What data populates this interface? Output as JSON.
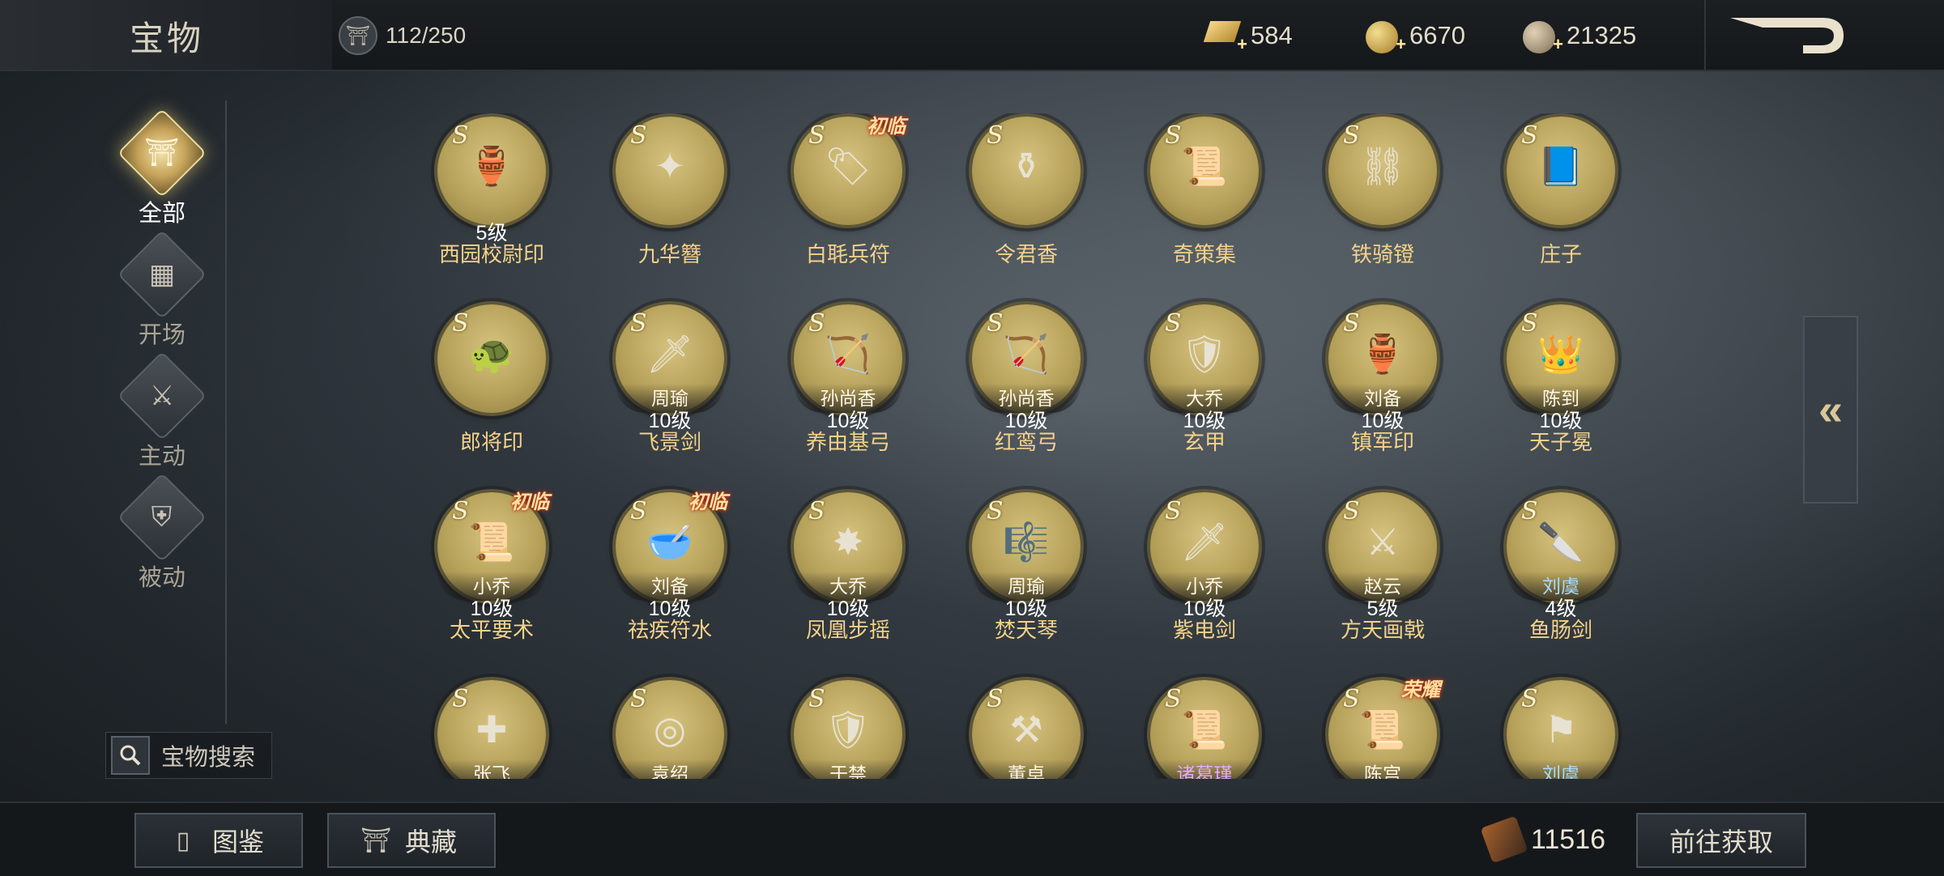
{
  "header": {
    "title": "宝物",
    "capacity": "112/250",
    "currencies": [
      {
        "name": "gold-ingot",
        "value": "584"
      },
      {
        "name": "gold-coin",
        "value": "6670"
      },
      {
        "name": "copper-coin",
        "value": "21325"
      }
    ]
  },
  "categories": [
    {
      "label": "全部",
      "icon": "treasure-icon",
      "active": true
    },
    {
      "label": "开场",
      "icon": "opening-icon",
      "active": false
    },
    {
      "label": "主动",
      "icon": "active-skill-icon",
      "active": false
    },
    {
      "label": "被动",
      "icon": "passive-skill-icon",
      "active": false
    }
  ],
  "search": {
    "label": "宝物搜索"
  },
  "items": [
    {
      "grade": "S",
      "tag": "",
      "owner": "",
      "level": "5级",
      "name": "西园校尉印",
      "art": "seal"
    },
    {
      "grade": "S",
      "tag": "",
      "owner": "",
      "level": "",
      "name": "九华簪",
      "art": "hairpin"
    },
    {
      "grade": "S",
      "tag": "初临",
      "owner": "",
      "level": "",
      "name": "白毦兵符",
      "art": "tally"
    },
    {
      "grade": "S",
      "tag": "",
      "owner": "",
      "level": "",
      "name": "令君香",
      "art": "censer"
    },
    {
      "grade": "S",
      "tag": "",
      "owner": "",
      "level": "",
      "name": "奇策集",
      "art": "scrolls"
    },
    {
      "grade": "S",
      "tag": "",
      "owner": "",
      "level": "",
      "name": "铁骑镫",
      "art": "stirrup"
    },
    {
      "grade": "S",
      "tag": "",
      "owner": "",
      "level": "",
      "name": "庄子",
      "art": "book"
    },
    {
      "grade": "S",
      "tag": "",
      "owner": "",
      "level": "",
      "name": "郎将印",
      "art": "turtle-seal"
    },
    {
      "grade": "S",
      "tag": "",
      "owner": "周瑜",
      "level": "10级",
      "name": "飞景剑",
      "art": "sword"
    },
    {
      "grade": "S",
      "tag": "",
      "owner": "孙尚香",
      "level": "10级",
      "name": "养由基弓",
      "art": "bow"
    },
    {
      "grade": "S",
      "tag": "",
      "owner": "孙尚香",
      "level": "10级",
      "name": "红鸾弓",
      "art": "bow"
    },
    {
      "grade": "S",
      "tag": "",
      "owner": "大乔",
      "level": "10级",
      "name": "玄甲",
      "art": "armor"
    },
    {
      "grade": "S",
      "tag": "",
      "owner": "刘备",
      "level": "10级",
      "name": "镇军印",
      "art": "seal"
    },
    {
      "grade": "S",
      "tag": "",
      "owner": "陈到",
      "level": "10级",
      "name": "天子冕",
      "art": "crown"
    },
    {
      "grade": "S",
      "tag": "初临",
      "owner": "小乔",
      "level": "10级",
      "name": "太平要术",
      "art": "scrolls"
    },
    {
      "grade": "S",
      "tag": "初临",
      "owner": "刘备",
      "level": "10级",
      "name": "祛疾符水",
      "art": "bowl"
    },
    {
      "grade": "S",
      "tag": "",
      "owner": "大乔",
      "level": "10级",
      "name": "凤凰步摇",
      "art": "phoenix"
    },
    {
      "grade": "S",
      "tag": "",
      "owner": "周瑜",
      "level": "10级",
      "name": "焚天琴",
      "art": "zither"
    },
    {
      "grade": "S",
      "tag": "",
      "owner": "小乔",
      "level": "10级",
      "name": "紫电剑",
      "art": "sword"
    },
    {
      "grade": "S",
      "tag": "",
      "owner": "赵云",
      "level": "5级",
      "name": "方天画戟",
      "art": "halberd"
    },
    {
      "grade": "S",
      "tag": "",
      "owner": "刘虞",
      "owner_color": "blue",
      "level": "4级",
      "name": "鱼肠剑",
      "art": "dagger"
    },
    {
      "grade": "S",
      "tag": "",
      "owner": "张飞",
      "level": "",
      "name": "",
      "art": "spear"
    },
    {
      "grade": "S",
      "tag": "",
      "owner": "袁绍",
      "level": "",
      "name": "",
      "art": "mirror"
    },
    {
      "grade": "S",
      "tag": "",
      "owner": "于禁",
      "level": "",
      "name": "",
      "art": "armor"
    },
    {
      "grade": "S",
      "tag": "",
      "owner": "董卓",
      "level": "",
      "name": "",
      "art": "blade"
    },
    {
      "grade": "S",
      "tag": "",
      "owner": "诸葛瑾",
      "owner_color": "purple",
      "level": "",
      "name": "",
      "art": "scrolls"
    },
    {
      "grade": "S",
      "tag": "荣耀",
      "owner": "陈宫",
      "level": "",
      "name": "",
      "art": "scrolls"
    },
    {
      "grade": "S",
      "tag": "",
      "owner": "刘虞",
      "owner_color": "blue",
      "level": "",
      "name": "",
      "art": "flag"
    }
  ],
  "footer": {
    "codex_label": "图鉴",
    "collection_label": "典藏",
    "fragment_count": "11516",
    "obtain_label": "前往获取"
  },
  "colors": {
    "accent_gold": "#f4d28a",
    "medal": "#c8b46c"
  }
}
